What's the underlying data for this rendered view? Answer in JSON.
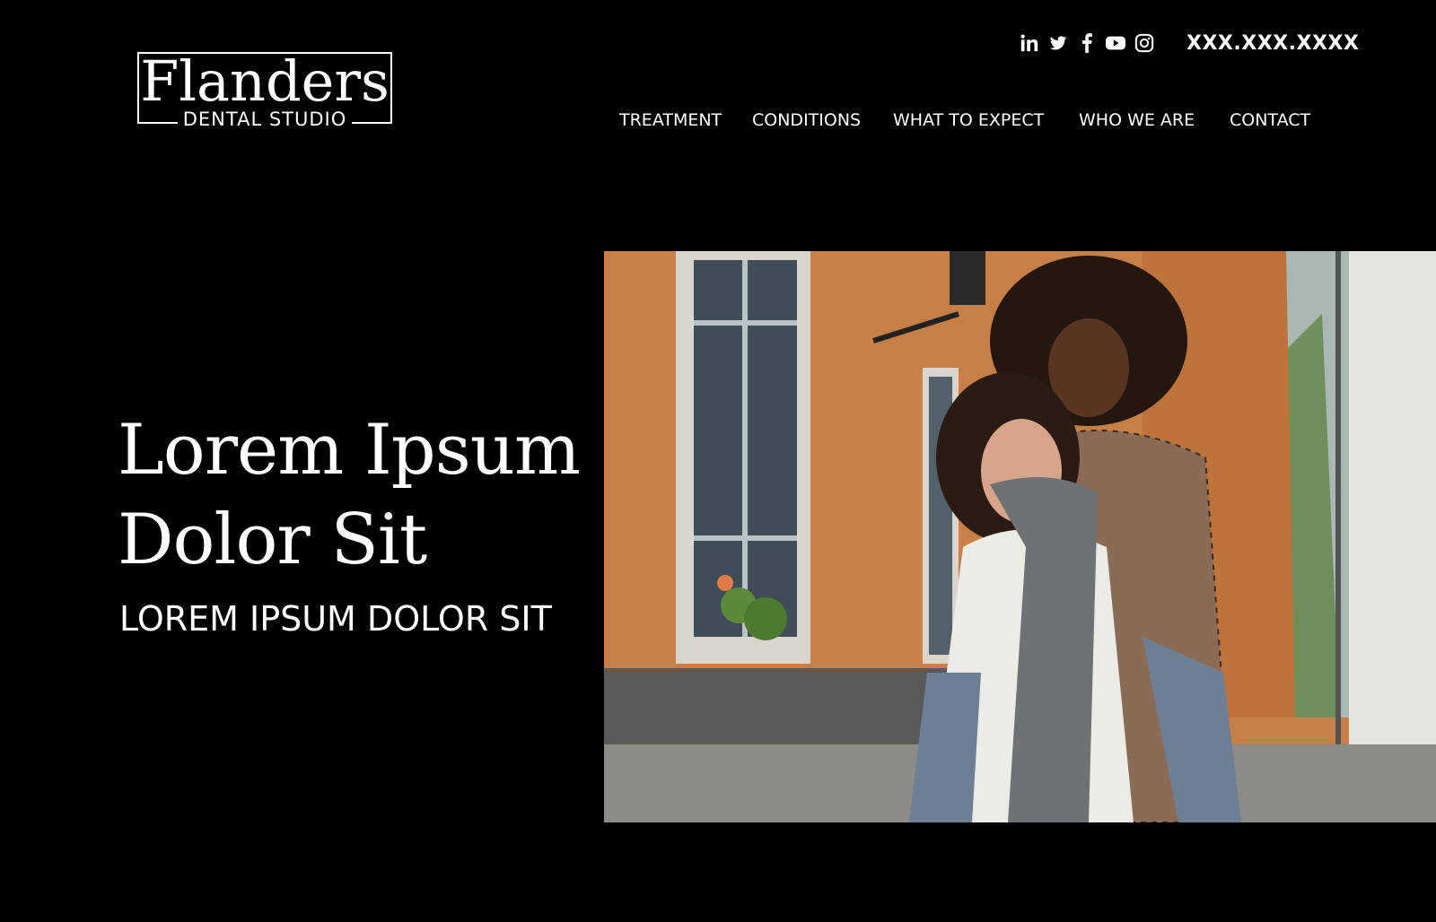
{
  "brand": {
    "name": "Flanders",
    "subtitle": "DENTAL STUDIO"
  },
  "header": {
    "social": [
      {
        "icon": "linkedin-icon"
      },
      {
        "icon": "twitter-icon"
      },
      {
        "icon": "facebook-icon"
      },
      {
        "icon": "youtube-icon"
      },
      {
        "icon": "instagram-icon"
      }
    ],
    "phone": "XXX.XXX.XXXX"
  },
  "nav": {
    "items": [
      "TREATMENT",
      "CONDITIONS",
      "WHAT TO EXPECT",
      "WHO WE ARE",
      "CONTACT"
    ]
  },
  "hero": {
    "title": "Lorem Ipsum Dolor Sit",
    "subtitle": "LOREM IPSUM DOLOR SIT",
    "image_alt": "Two laughing women, one carrying the other piggyback on a city street"
  },
  "colors": {
    "background": "#000000",
    "text": "#ffffff",
    "facade": "#d08a50"
  }
}
